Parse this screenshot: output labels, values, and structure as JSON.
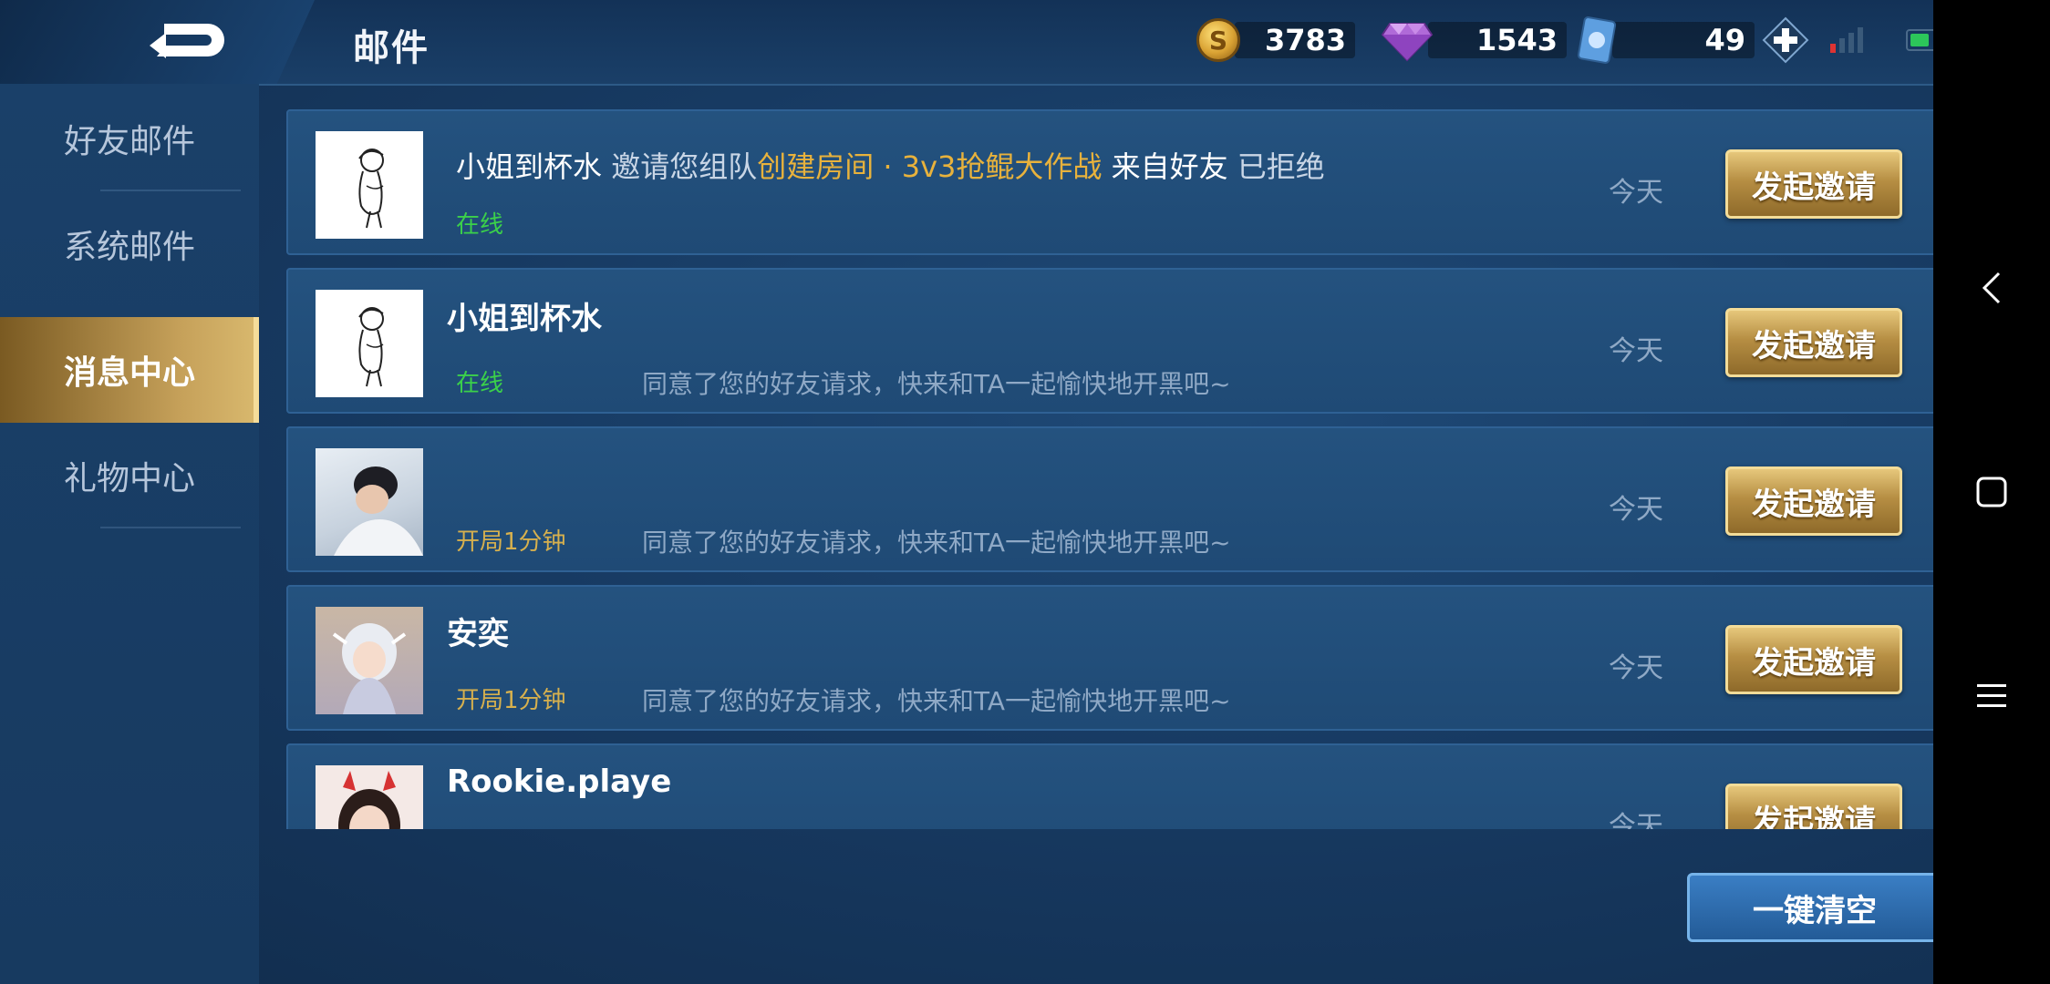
{
  "header": {
    "title": "邮件",
    "gold": "3783",
    "diamonds": "1543",
    "tickets": "49",
    "coin_symbol": "S"
  },
  "sidebar": {
    "items": [
      {
        "label": "好友邮件",
        "active": false
      },
      {
        "label": "系统邮件",
        "active": false
      },
      {
        "label": "消息中心",
        "active": true
      },
      {
        "label": "礼物中心",
        "active": false
      }
    ]
  },
  "messages": [
    {
      "name": "小姐到杯水",
      "text_invite": "邀请您组队",
      "text_room": "创建房间 · 3v3抢鲲大作战",
      "text_from": "来自好友",
      "text_state": "已拒绝",
      "status": "在线",
      "status_type": "online",
      "time": "今天",
      "button": "发起邀请",
      "avatar": "sketch-avatar"
    },
    {
      "name": "小姐到杯水",
      "status": "在线",
      "status_type": "online",
      "message": "同意了您的好友请求，快来和TA一起愉快地开黑吧~",
      "time": "今天",
      "button": "发起邀请",
      "avatar": "sketch-avatar"
    },
    {
      "name": "",
      "status": "开局1分钟",
      "status_type": "playing",
      "message": "同意了您的好友请求，快来和TA一起愉快地开黑吧~",
      "time": "今天",
      "button": "发起邀请",
      "avatar": "photo-avatar"
    },
    {
      "name": "安奕",
      "status": "开局1分钟",
      "status_type": "playing",
      "message": "同意了您的好友请求，快来和TA一起愉快地开黑吧~",
      "time": "今天",
      "button": "发起邀请",
      "avatar": "anime-avatar"
    },
    {
      "name": "Rookie.playe",
      "status": "",
      "status_type": "",
      "message": "",
      "time": "今天",
      "button": "发起邀请",
      "avatar": "girl-avatar"
    }
  ],
  "footer": {
    "clear_all": "一键清空"
  },
  "colors": {
    "gold_accent": "#e8b23c",
    "online": "#3bd14a",
    "playing": "#d6b04e"
  }
}
